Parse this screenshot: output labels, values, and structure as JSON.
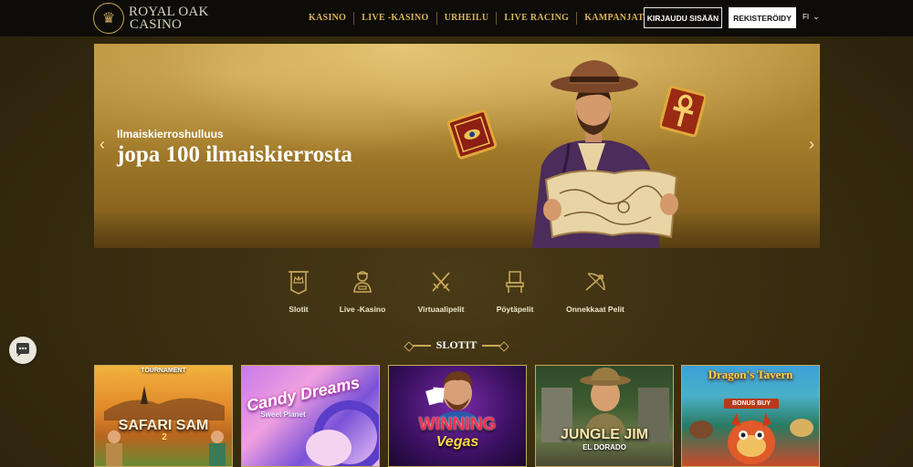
{
  "header": {
    "logo_line1": "ROYAL OAK",
    "logo_line2": "CASINO",
    "nav": [
      "KASINO",
      "LIVE -KASINO",
      "URHEILU",
      "LIVE RACING",
      "KAMPANJAT"
    ],
    "login_label": "KIRJAUDU SISÄÄN",
    "register_label": "REKISTERÖIDY",
    "language": "FI"
  },
  "hero": {
    "subtitle": "Ilmaiskierroshulluus",
    "title": "jopa 100 ilmaiskierrosta"
  },
  "categories": [
    {
      "label": "Slotit",
      "icon": "banner-crown-icon"
    },
    {
      "label": "Live -Kasino",
      "icon": "dealer-icon"
    },
    {
      "label": "Virtuaalipelit",
      "icon": "crossed-swords-icon"
    },
    {
      "label": "Pöytäpelit",
      "icon": "throne-icon"
    },
    {
      "label": "Onnekkaat Pelit",
      "icon": "bow-arrow-icon"
    }
  ],
  "section": {
    "title": "SLOTIT"
  },
  "games": [
    {
      "badge": "TOURNAMENT",
      "title": "SAFARI SAM",
      "sub": "2"
    },
    {
      "title": "Candy Dreams",
      "sub": "Sweet Planet"
    },
    {
      "title": "WINNING",
      "sub": "Vegas"
    },
    {
      "title": "JUNGLE JIM",
      "sub": "EL DORADO"
    },
    {
      "title": "Dragon's Tavern",
      "sub": "BONUS BUY"
    }
  ],
  "colors": {
    "accent": "#d9b45a",
    "header_bg": "#0e0c08",
    "page_bg": "#3a2f12"
  }
}
